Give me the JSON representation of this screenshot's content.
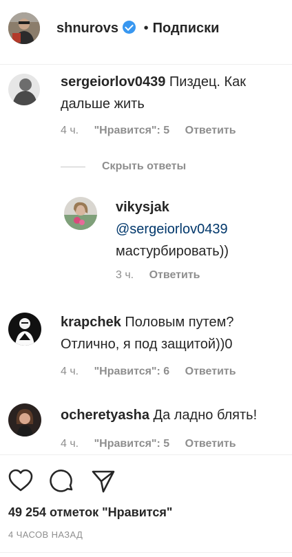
{
  "header": {
    "username": "shnurovs",
    "separator": "•",
    "follow_label": "Подписки"
  },
  "comments": [
    {
      "username": "sergeiorlov0439",
      "text": "Пиздец. Как дальше жить",
      "time": "4 ч.",
      "likes": "\"Нравится\": 5",
      "reply": "Ответить"
    },
    {
      "username": "krapchek",
      "text": "Половым путем? Отлично, я под защитой))0",
      "time": "4 ч.",
      "likes": "\"Нравится\": 6",
      "reply": "Ответить"
    },
    {
      "username": "ocheretyasha",
      "text": "Да ладно блять!",
      "time": "4 ч.",
      "likes": "\"Нравится\": 5",
      "reply": "Ответить"
    }
  ],
  "hide_replies": "Скрыть ответы",
  "reply_thread": {
    "username": "vikysjak",
    "mention": "@sergeiorlov0439",
    "text": "мастурбировать))",
    "time": "3 ч.",
    "reply": "Ответить"
  },
  "actions": {
    "like_icon": "heart-icon",
    "comment_icon": "comment-bubble-icon",
    "share_icon": "paper-plane-icon"
  },
  "likes_count": "49 254 отметок \"Нравится\"",
  "post_time": "4 ЧАСОВ НАЗАД"
}
